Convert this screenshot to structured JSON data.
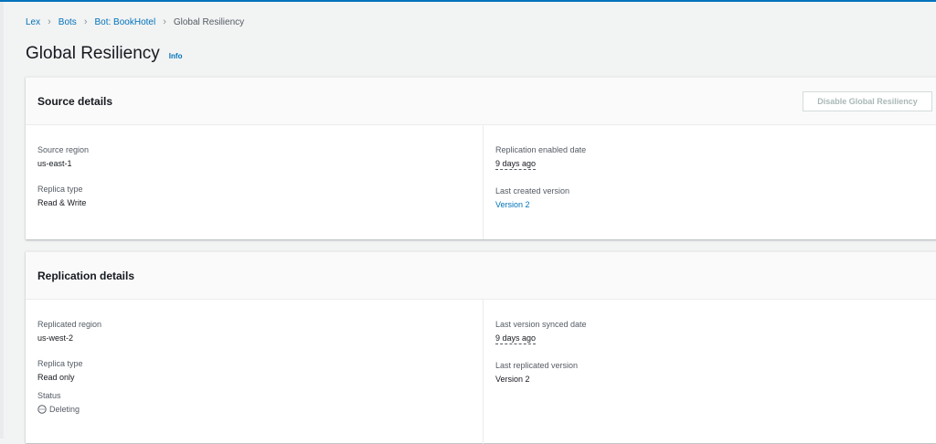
{
  "breadcrumb": [
    "Lex",
    "Bots",
    "Bot: BookHotel",
    "Global Resiliency"
  ],
  "page": {
    "title": "Global Resiliency",
    "info": "Info"
  },
  "source": {
    "title": "Source details",
    "button": "Disable Global Resiliency",
    "source_region_label": "Source region",
    "source_region": "us-east-1",
    "replica_type_label": "Replica type",
    "replica_type": "Read & Write",
    "enabled_date_label": "Replication enabled date",
    "enabled_date": "9 days ago",
    "last_created_label": "Last created version",
    "last_created": "Version 2"
  },
  "replication": {
    "title": "Replication details",
    "region_label": "Replicated region",
    "region": "us-west-2",
    "replica_type_label": "Replica type",
    "replica_type": "Read only",
    "status_label": "Status",
    "status": "Deleting",
    "synced_label": "Last version synced date",
    "synced": "9 days ago",
    "replicated_label": "Last replicated version",
    "replicated": "Version 2"
  }
}
